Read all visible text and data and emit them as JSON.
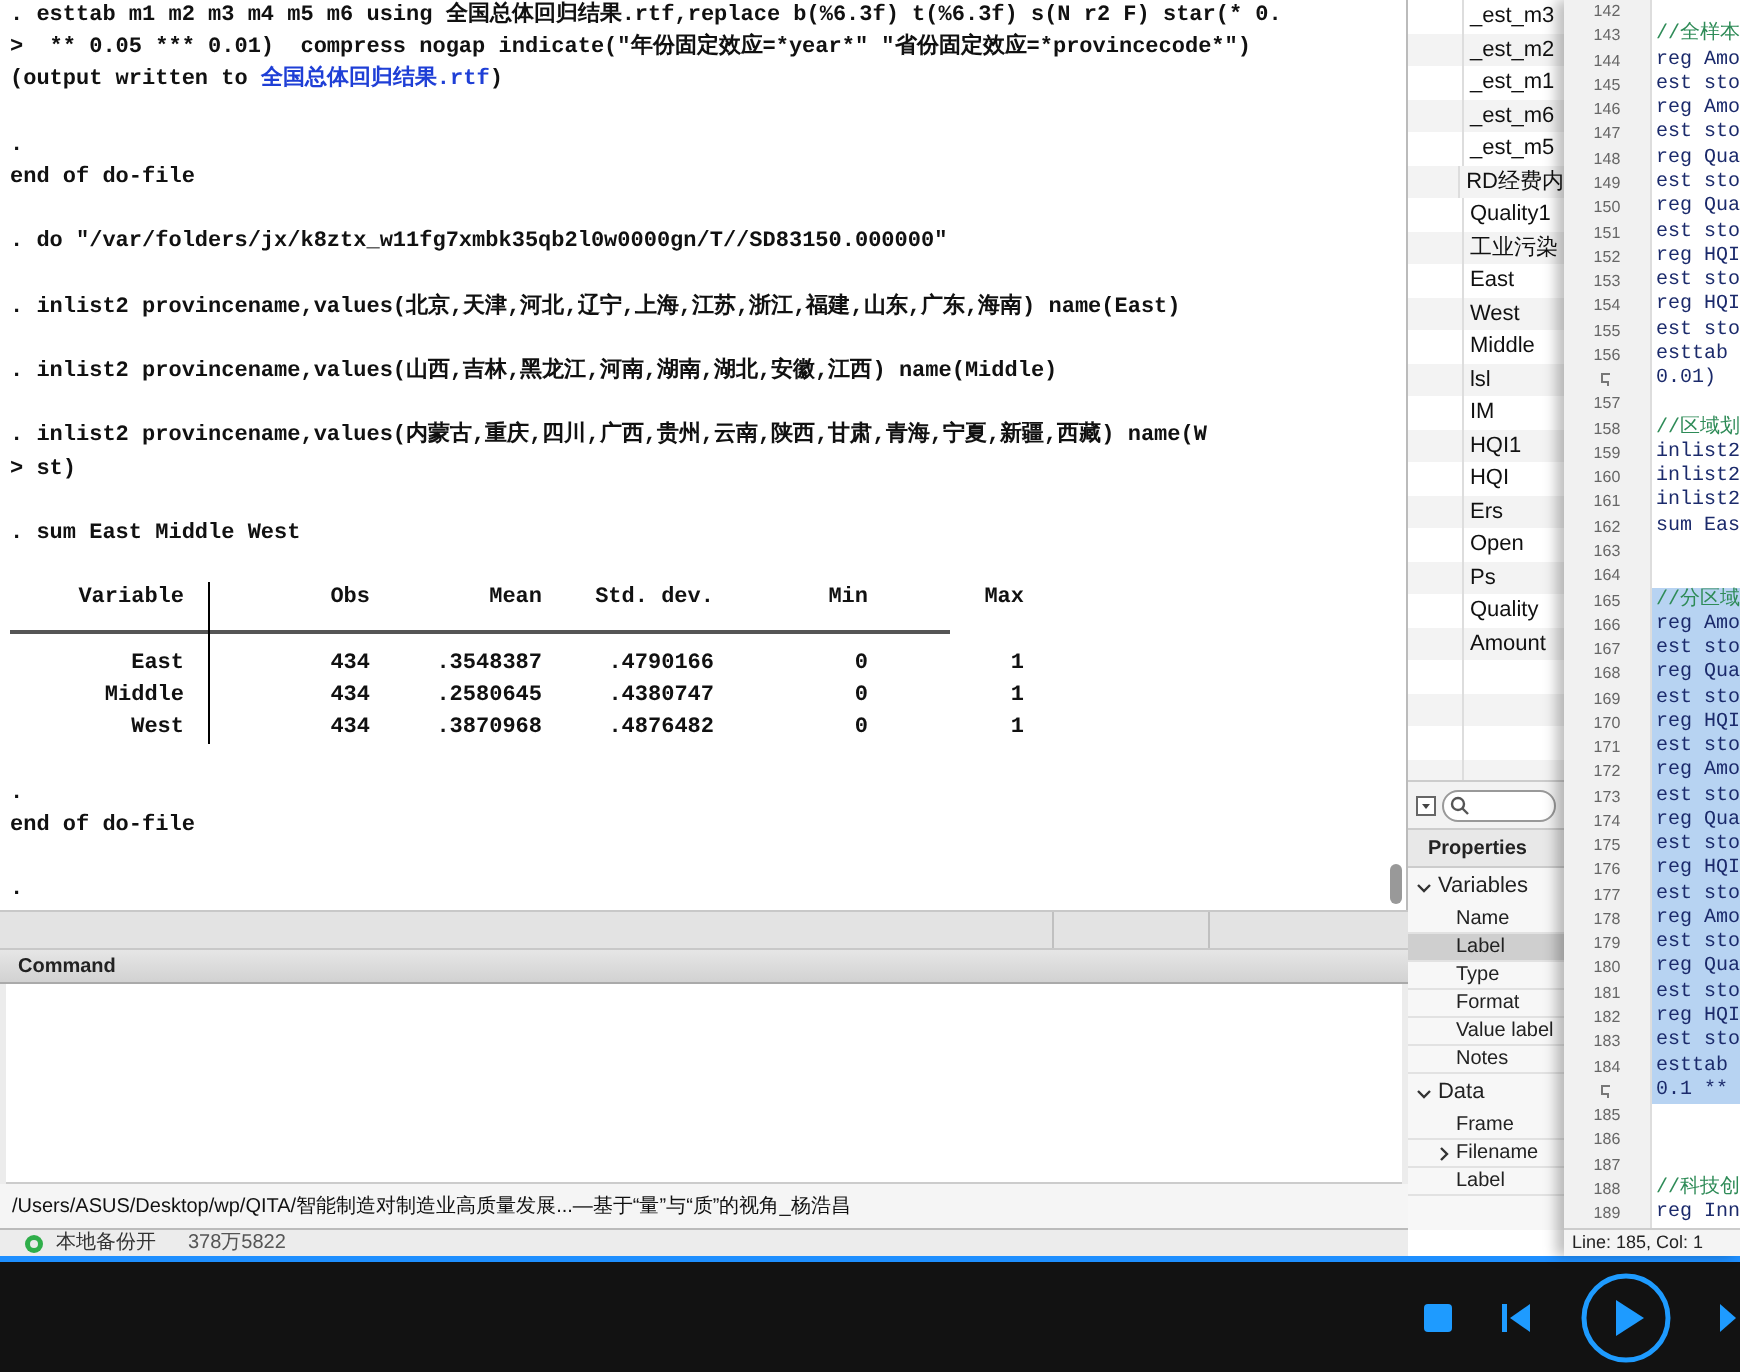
{
  "results": {
    "lines": [
      {
        "kind": "text",
        "text": ". esttab m1 m2 m3 m4 m5 m6 using 全国总体回归结果.rtf,replace b(%6.3f) t(%6.3f) s(N r2 F) star(* 0."
      },
      {
        "kind": "text",
        "text": ">  ** 0.05 *** 0.01)  compress nogap indicate(\"年份固定效应=*year*\" \"省份固定效应=*provincecode*\")"
      },
      {
        "kind": "link",
        "before": "(output written to ",
        "link": "全国总体回归结果.rtf",
        "after": ")"
      },
      {
        "kind": "blank"
      },
      {
        "kind": "text",
        "text": "."
      },
      {
        "kind": "text",
        "text": "end of do-file"
      },
      {
        "kind": "blank"
      },
      {
        "kind": "text",
        "text": ". do \"/var/folders/jx/k8ztx_w11fg7xmbk35qb2l0w0000gn/T//SD83150.000000\""
      },
      {
        "kind": "blank"
      },
      {
        "kind": "text",
        "text": ". inlist2 provincename,values(北京,天津,河北,辽宁,上海,江苏,浙江,福建,山东,广东,海南) name(East)"
      },
      {
        "kind": "blank"
      },
      {
        "kind": "text",
        "text": ". inlist2 provincename,values(山西,吉林,黑龙江,河南,湖南,湖北,安徽,江西) name(Middle)"
      },
      {
        "kind": "blank"
      },
      {
        "kind": "text",
        "text": ". inlist2 provincename,values(内蒙古,重庆,四川,广西,贵州,云南,陕西,甘肃,青海,宁夏,新疆,西藏) name(W"
      },
      {
        "kind": "text",
        "text": "> st)"
      },
      {
        "kind": "blank"
      },
      {
        "kind": "text",
        "text": ". sum East Middle West"
      },
      {
        "kind": "blank"
      },
      {
        "kind": "table",
        "columns": [
          "Variable",
          "Obs",
          "Mean",
          "Std. dev.",
          "Min",
          "Max"
        ],
        "rows": [
          [
            "East",
            "434",
            ".3548387",
            ".4790166",
            "0",
            "1"
          ],
          [
            "Middle",
            "434",
            ".2580645",
            ".4380747",
            "0",
            "1"
          ],
          [
            "West",
            "434",
            ".3870968",
            ".4876482",
            "0",
            "1"
          ]
        ]
      },
      {
        "kind": "blank"
      },
      {
        "kind": "text",
        "text": "."
      },
      {
        "kind": "text",
        "text": "end of do-file"
      },
      {
        "kind": "blank"
      },
      {
        "kind": "text",
        "text": "."
      }
    ]
  },
  "command": {
    "title": "Command"
  },
  "path_bar": "/Users/ASUS/Desktop/wp/QITA/智能制造对制造业高质量发展...—基于“量”与“质”的视角_杨浩昌",
  "background_status": {
    "label": "本地备份开",
    "size": "378万5822"
  },
  "variables": [
    "_est_m3",
    "_est_m2",
    "_est_m1",
    "_est_m6",
    "_est_m5",
    "RD经费内",
    "Quality1",
    "工业污染",
    "East",
    "West",
    "Middle",
    "lsl",
    "IM",
    "HQI1",
    "HQI",
    "Ers",
    "Open",
    "Ps",
    "Quality",
    "Amount"
  ],
  "properties": {
    "title": "Properties",
    "groups": [
      {
        "label": "Variables",
        "expanded": true,
        "items": [
          {
            "label": "Name",
            "kind": "field",
            "selected": false
          },
          {
            "label": "Label",
            "kind": "field",
            "selected": true
          },
          {
            "label": "Type",
            "kind": "field",
            "selected": false
          },
          {
            "label": "Format",
            "kind": "field",
            "selected": false
          },
          {
            "label": "Value label",
            "kind": "field",
            "selected": false
          },
          {
            "label": "Notes",
            "kind": "field",
            "selected": false
          }
        ]
      },
      {
        "label": "Data",
        "expanded": true,
        "items": [
          {
            "label": "Frame",
            "kind": "field",
            "selected": false
          },
          {
            "label": "Filename",
            "kind": "group",
            "selected": false
          },
          {
            "label": "Label",
            "kind": "field",
            "selected": false
          }
        ]
      }
    ]
  },
  "editor": {
    "lines": [
      {
        "kind": "line",
        "number": "142",
        "selected": false
      },
      {
        "kind": "line",
        "number": "143",
        "code": "//全样本",
        "selected": false,
        "comment": true
      },
      {
        "kind": "line",
        "number": "144",
        "code": "reg Amo",
        "selected": false,
        "comment": false
      },
      {
        "kind": "line",
        "number": "145",
        "code": "est sto",
        "selected": false,
        "comment": false
      },
      {
        "kind": "line",
        "number": "146",
        "code": "reg Amo",
        "selected": false,
        "comment": false
      },
      {
        "kind": "line",
        "number": "147",
        "code": "est sto",
        "selected": false,
        "comment": false
      },
      {
        "kind": "line",
        "number": "148",
        "code": "reg Qua",
        "selected": false,
        "comment": false
      },
      {
        "kind": "line",
        "number": "149",
        "code": "est sto",
        "selected": false,
        "comment": false
      },
      {
        "kind": "line",
        "number": "150",
        "code": "reg Qua",
        "selected": false,
        "comment": false
      },
      {
        "kind": "line",
        "number": "151",
        "code": "est sto",
        "selected": false,
        "comment": false
      },
      {
        "kind": "line",
        "number": "152",
        "code": "reg HQI",
        "selected": false,
        "comment": false
      },
      {
        "kind": "line",
        "number": "153",
        "code": "est sto",
        "selected": false,
        "comment": false
      },
      {
        "kind": "line",
        "number": "154",
        "code": "reg HQI",
        "selected": false,
        "comment": false
      },
      {
        "kind": "line",
        "number": "155",
        "code": "est sto",
        "selected": false,
        "comment": false
      },
      {
        "kind": "line",
        "number": "156",
        "code": "esttab",
        "selected": false,
        "comment": false
      },
      {
        "kind": "wrap",
        "code": "0.01)",
        "selected": false,
        "comment": false
      },
      {
        "kind": "line",
        "number": "157",
        "selected": false
      },
      {
        "kind": "line",
        "number": "158",
        "code": "//区域划",
        "selected": false,
        "comment": true
      },
      {
        "kind": "line",
        "number": "159",
        "code": "inlist2",
        "selected": false,
        "comment": false
      },
      {
        "kind": "line",
        "number": "160",
        "code": "inlist2",
        "selected": false,
        "comment": false
      },
      {
        "kind": "line",
        "number": "161",
        "code": "inlist2",
        "selected": false,
        "comment": false
      },
      {
        "kind": "line",
        "number": "162",
        "code": "sum Eas",
        "selected": false,
        "comment": false
      },
      {
        "kind": "line",
        "number": "163",
        "selected": false
      },
      {
        "kind": "line",
        "number": "164",
        "selected": false
      },
      {
        "kind": "line",
        "number": "165",
        "code": "//分区域",
        "selected": true,
        "comment": true
      },
      {
        "kind": "line",
        "number": "166",
        "code": "reg Amo",
        "selected": true,
        "comment": false
      },
      {
        "kind": "line",
        "number": "167",
        "code": "est sto",
        "selected": true,
        "comment": false
      },
      {
        "kind": "line",
        "number": "168",
        "code": "reg Qua",
        "selected": true,
        "comment": false
      },
      {
        "kind": "line",
        "number": "169",
        "code": "est sto",
        "selected": true,
        "comment": false
      },
      {
        "kind": "line",
        "number": "170",
        "code": "reg HQI",
        "selected": true,
        "comment": false
      },
      {
        "kind": "line",
        "number": "171",
        "code": "est sto",
        "selected": true,
        "comment": false
      },
      {
        "kind": "line",
        "number": "172",
        "code": "reg Amo",
        "selected": true,
        "comment": false
      },
      {
        "kind": "line",
        "number": "173",
        "code": "est sto",
        "selected": true,
        "comment": false
      },
      {
        "kind": "line",
        "number": "174",
        "code": "reg Qua",
        "selected": true,
        "comment": false
      },
      {
        "kind": "line",
        "number": "175",
        "code": "est sto",
        "selected": true,
        "comment": false
      },
      {
        "kind": "line",
        "number": "176",
        "code": "reg HQI",
        "selected": true,
        "comment": false
      },
      {
        "kind": "line",
        "number": "177",
        "code": "est sto",
        "selected": true,
        "comment": false
      },
      {
        "kind": "line",
        "number": "178",
        "code": "reg Amo",
        "selected": true,
        "comment": false
      },
      {
        "kind": "line",
        "number": "179",
        "code": "est sto",
        "selected": true,
        "comment": false
      },
      {
        "kind": "line",
        "number": "180",
        "code": "reg Qua",
        "selected": true,
        "comment": false
      },
      {
        "kind": "line",
        "number": "181",
        "code": "est sto",
        "selected": true,
        "comment": false
      },
      {
        "kind": "line",
        "number": "182",
        "code": "reg HQI",
        "selected": true,
        "comment": false
      },
      {
        "kind": "line",
        "number": "183",
        "code": "est sto",
        "selected": true,
        "comment": false
      },
      {
        "kind": "line",
        "number": "184",
        "code": "esttab",
        "selected": true,
        "comment": false
      },
      {
        "kind": "wrap",
        "code": "0.1 **",
        "selected": true,
        "comment": false
      },
      {
        "kind": "line",
        "number": "185",
        "selected": false
      },
      {
        "kind": "line",
        "number": "186",
        "selected": false
      },
      {
        "kind": "line",
        "number": "187",
        "selected": false
      },
      {
        "kind": "line",
        "number": "188",
        "code": "//科技创",
        "selected": false,
        "comment": true
      },
      {
        "kind": "line",
        "number": "189",
        "code": "reg Inn",
        "selected": false,
        "comment": false
      }
    ],
    "status": "Line: 185, Col: 1"
  }
}
